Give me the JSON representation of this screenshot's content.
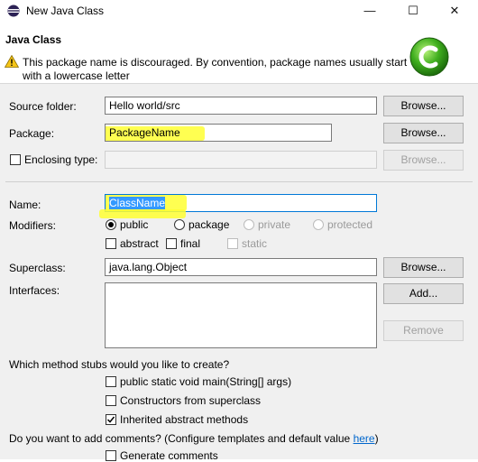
{
  "window": {
    "title": "New Java Class",
    "minimize_glyph": "—",
    "maximize_glyph": "☐",
    "close_glyph": "✕"
  },
  "header": {
    "title": "Java Class",
    "warning": "This package name is discouraged. By convention, package names usually start with a lowercase letter"
  },
  "form": {
    "source_folder_label": "Source folder:",
    "source_folder_value": "Hello world/src",
    "package_label": "Package:",
    "package_value": "PackageName",
    "enclosing_type_label": "Enclosing type:",
    "enclosing_type_value": "",
    "name_label": "Name:",
    "name_value": "ClassName",
    "modifiers_label": "Modifiers:",
    "modifiers": {
      "public": "public",
      "package": "package",
      "private": "private",
      "protected": "protected",
      "abstract": "abstract",
      "final": "final",
      "static": "static"
    },
    "superclass_label": "Superclass:",
    "superclass_value": "java.lang.Object",
    "interfaces_label": "Interfaces:",
    "stubs_question": "Which method stubs would you like to create?",
    "stubs": {
      "main": "public static void main(String[] args)",
      "constructors": "Constructors from superclass",
      "inherited": "Inherited abstract methods"
    },
    "comments_question_prefix": "Do you want to add comments? (Configure templates and default value ",
    "comments_link": "here",
    "comments_question_suffix": ")",
    "generate_comments": "Generate comments"
  },
  "buttons": {
    "browse": "Browse...",
    "add": "Add...",
    "remove": "Remove"
  },
  "colors": {
    "highlight": "#ffff33",
    "selection": "#3399ff",
    "link": "#0066cc"
  }
}
